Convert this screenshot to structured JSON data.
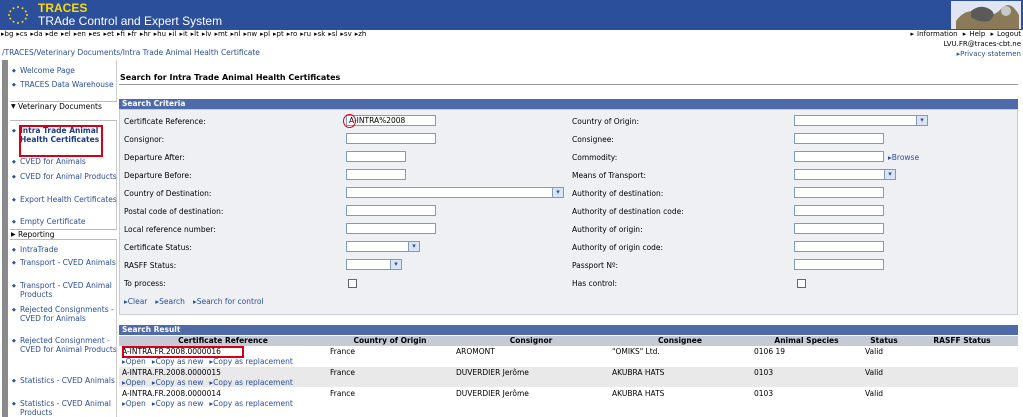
{
  "app": {
    "title": "TRACES",
    "subtitle": "TRAde Control and Expert System"
  },
  "languages": [
    "bg",
    "cs",
    "da",
    "de",
    "el",
    "en",
    "es",
    "et",
    "fi",
    "fr",
    "hr",
    "hu",
    "il",
    "it",
    "lt",
    "lv",
    "mt",
    "nl",
    "nw",
    "pl",
    "pt",
    "ro",
    "ru",
    "sk",
    "sl",
    "sv",
    "zh"
  ],
  "top_links": [
    "Information",
    "Help",
    "Logout"
  ],
  "user": "LVU.FR@traces-cbt.ne",
  "breadcrumb": [
    "/TRACES/",
    "Veterinary Documents",
    "/Intra Trade Animal Health Certificate"
  ],
  "privacy_label": "Privacy statemen",
  "sidebar": {
    "items_top": [
      "Welcome Page",
      "TRACES Data Warehouse"
    ],
    "section_vet": "Veterinary Documents",
    "vet_items": [
      "Intra Trade Animal Health Certificates",
      "CVED for Animals",
      "CVED for Animal Products",
      "Export Health Certificates",
      "Empty Certificate"
    ],
    "section_reporting": "Reporting",
    "reporting_items": [
      "IntraTrade",
      "Transport - CVED Animals",
      "Transport - CVED Animal Products",
      "Rejected Consignments - CVED for Animals",
      "Rejected Consignment - CVED for Animal Products",
      "Statistics - CVED Animals",
      "Statistics - CVED Animal Products"
    ]
  },
  "page": {
    "title": "Search for Intra Trade Animal Health Certificates",
    "criteria_header": "Search Criteria",
    "result_header": "Search Result"
  },
  "criteria": {
    "left": {
      "certificate_reference": {
        "label": "Certificate Reference:",
        "value": "A-INTRA%2008"
      },
      "consignor": {
        "label": "Consignor:",
        "value": ""
      },
      "departure_after": {
        "label": "Departure After:",
        "value": ""
      },
      "departure_before": {
        "label": "Departure Before:",
        "value": ""
      },
      "country_destination": {
        "label": "Country of Destination:",
        "value": ""
      },
      "postal_code": {
        "label": "Postal code of destination:",
        "value": ""
      },
      "local_ref": {
        "label": "Local reference number:",
        "value": ""
      },
      "cert_status": {
        "label": "Certificate Status:",
        "value": ""
      },
      "rasff_status": {
        "label": "RASFF Status:",
        "value": ""
      },
      "to_process": {
        "label": "To process:"
      }
    },
    "right": {
      "country_origin": {
        "label": "Country of Origin:",
        "value": ""
      },
      "consignee": {
        "label": "Consignee:",
        "value": ""
      },
      "commodity": {
        "label": "Commodity:",
        "value": ""
      },
      "browse": "Browse",
      "means_transport": {
        "label": "Means of Transport:",
        "value": ""
      },
      "authority_destination": {
        "label": "Authority of destination:",
        "value": ""
      },
      "authority_destination_code": {
        "label": "Authority of destination code:",
        "value": ""
      },
      "authority_origin": {
        "label": "Authority of origin:",
        "value": ""
      },
      "authority_origin_code": {
        "label": "Authority of origin code:",
        "value": ""
      },
      "passport": {
        "label": "Passport Nº:",
        "value": ""
      },
      "has_control": {
        "label": "Has control:"
      }
    },
    "actions": [
      "Clear",
      "Search",
      "Search for control"
    ]
  },
  "results": {
    "columns": [
      "Certificate Reference",
      "Country of Origin",
      "Consignor",
      "Consignee",
      "Animal Species",
      "Status",
      "RASFF Status"
    ],
    "rows": [
      {
        "ref": "A-INTRA.FR.2008.0000016",
        "country": "France",
        "consignor": "AROMONT",
        "consignee": "\"OMIKS\" Ltd.",
        "species": "0106 19",
        "status": "Valid",
        "rasff": ""
      },
      {
        "ref": "A-INTRA.FR.2008.0000015",
        "country": "France",
        "consignor": "DUVERDIER Jerôme",
        "consignee": "AKUBRA HATS",
        "species": "0103",
        "status": "Valid",
        "rasff": ""
      },
      {
        "ref": "A-INTRA.FR.2008.0000014",
        "country": "France",
        "consignor": "DUVERDIER Jerôme",
        "consignee": "AKUBRA HATS",
        "species": "0103",
        "status": "Valid",
        "rasff": ""
      }
    ],
    "row_actions": [
      "Open",
      "Copy as new",
      "Copy as replacement"
    ]
  }
}
